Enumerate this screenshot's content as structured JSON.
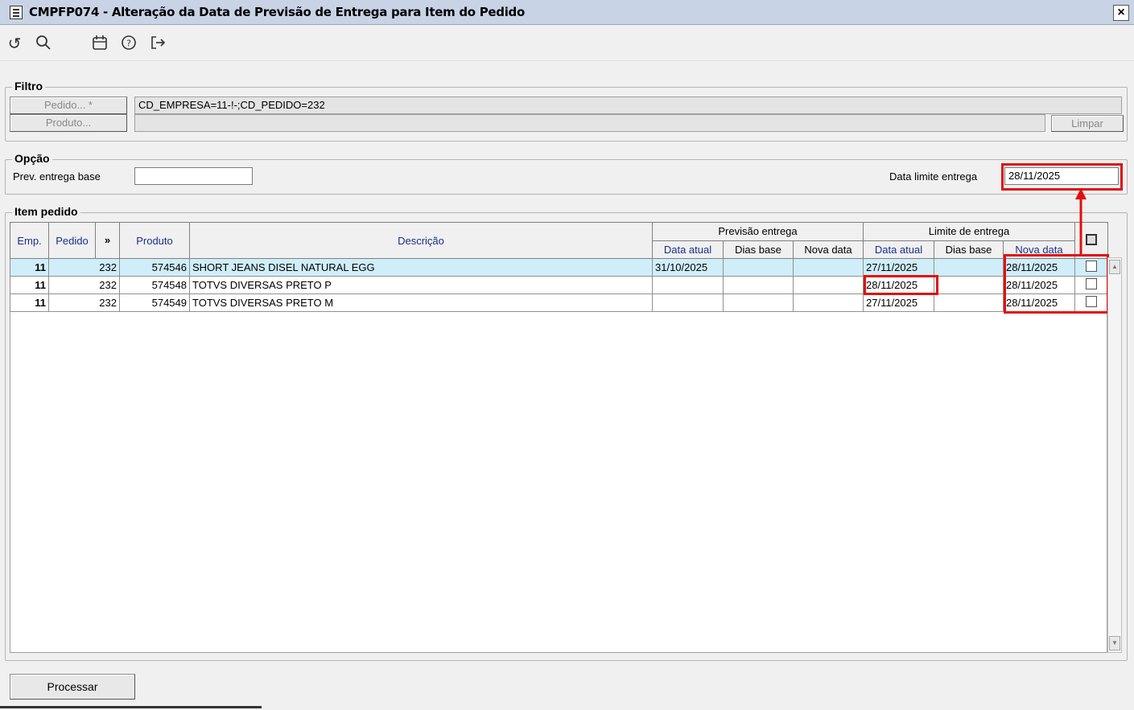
{
  "window": {
    "title": "CMPFP074 - Alteração da Data de Previsão de Entrega para Item do Pedido",
    "close_label": "×"
  },
  "toolbar": {
    "icons": [
      "refresh-icon",
      "search-icon",
      "calendar-icon",
      "help-icon",
      "exit-icon"
    ],
    "refresh_glyph": "↺",
    "search_glyph": "⚲",
    "calendar_glyph": "🗓",
    "help_glyph": "?",
    "exit_glyph": "↦"
  },
  "filtro": {
    "label": "Filtro",
    "pedido_button": "Pedido... *",
    "produto_button": "Produto...",
    "pedido_value": "CD_EMPRESA=11-!-;CD_PEDIDO=232",
    "produto_value": "",
    "limpar_button": "Limpar"
  },
  "opcao": {
    "label": "Opção",
    "prev_entrega_label": "Prev. entrega base",
    "prev_entrega_value": "",
    "data_limite_label": "Data limite entrega",
    "data_limite_value": "28/11/2025"
  },
  "item_pedido": {
    "label": "Item pedido",
    "columns": {
      "emp": "Emp.",
      "pedido": "Pedido",
      "more": "»",
      "produto": "Produto",
      "descricao": "Descrição",
      "previsao_group": "Previsão entrega",
      "limite_group": "Limite de entrega",
      "data_atual": "Data atual",
      "dias_base": "Dias base",
      "nova_data": "Nova data"
    },
    "rows": [
      {
        "emp": "11",
        "pedido": "232",
        "produto": "574546",
        "descricao": "SHORT JEANS DISEL NATURAL EGG",
        "prev_data_atual": "31/10/2025",
        "prev_dias_base": "",
        "prev_nova_data": "",
        "lim_data_atual": "27/11/2025",
        "lim_dias_base": "",
        "lim_nova_data": "28/11/2025",
        "selected": true
      },
      {
        "emp": "11",
        "pedido": "232",
        "produto": "574548",
        "descricao": "TOTVS DIVERSAS PRETO P",
        "prev_data_atual": "",
        "prev_dias_base": "",
        "prev_nova_data": "",
        "lim_data_atual": "28/11/2025",
        "lim_dias_base": "",
        "lim_nova_data": "28/11/2025",
        "selected": false
      },
      {
        "emp": "11",
        "pedido": "232",
        "produto": "574549",
        "descricao": "TOTVS DIVERSAS PRETO M",
        "prev_data_atual": "",
        "prev_dias_base": "",
        "prev_nova_data": "",
        "lim_data_atual": "27/11/2025",
        "lim_dias_base": "",
        "lim_nova_data": "28/11/2025",
        "selected": false
      }
    ]
  },
  "footer": {
    "processar_button": "Processar"
  },
  "colors": {
    "highlight_red": "#e01010",
    "selected_row": "#cfeefa",
    "header_text": "#1b2f8c",
    "titlebar": "#c9d3e6"
  }
}
